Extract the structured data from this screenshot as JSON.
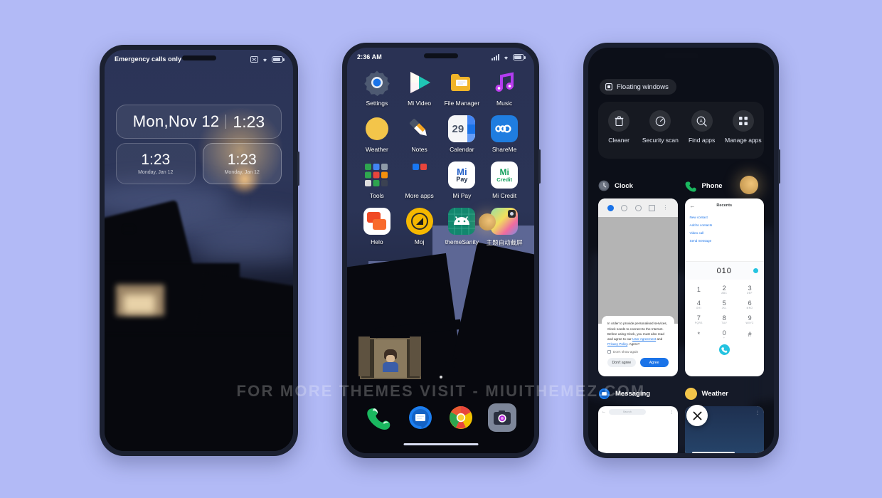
{
  "background_color": "#b2baf6",
  "watermark": "FOR MORE THEMES VISIT - MIUITHEMEZ.COM",
  "lockscreen": {
    "status_left": "Emergency calls only",
    "status_icons": [
      "no-sim-icon",
      "wifi-icon",
      "battery-icon"
    ],
    "widget_date": "Mon,Nov 12",
    "widget_time": "1:23",
    "small_widgets": [
      {
        "time": "1:23",
        "sub": "Monday, Jan 12"
      },
      {
        "time": "1:23",
        "sub": "Monday, Jan 12"
      }
    ]
  },
  "homescreen": {
    "status_time": "2:36 AM",
    "status_icons": [
      "signal-icon",
      "wifi-icon",
      "battery-icon"
    ],
    "apps": [
      {
        "label": "Settings",
        "icon": "settings-icon"
      },
      {
        "label": "Mi Video",
        "icon": "mi-video-icon"
      },
      {
        "label": "File Manager",
        "icon": "file-manager-icon"
      },
      {
        "label": "Music",
        "icon": "music-icon"
      },
      {
        "label": "Weather",
        "icon": "weather-icon"
      },
      {
        "label": "Notes",
        "icon": "notes-icon"
      },
      {
        "label": "Calendar",
        "icon": "calendar-icon",
        "badge": "29"
      },
      {
        "label": "ShareMe",
        "icon": "shareme-icon"
      },
      {
        "label": "Tools",
        "icon": "tools-folder-icon"
      },
      {
        "label": "More apps",
        "icon": "more-apps-folder-icon"
      },
      {
        "label": "Mi Pay",
        "icon": "mi-pay-icon"
      },
      {
        "label": "Mi Credit",
        "icon": "mi-credit-icon"
      },
      {
        "label": "Helo",
        "icon": "helo-icon"
      },
      {
        "label": "Moj",
        "icon": "moj-icon"
      },
      {
        "label": "themeSanity",
        "icon": "themesanity-icon"
      },
      {
        "label": "主题自动截屏",
        "icon": "auto-screenshot-icon"
      }
    ],
    "dock": [
      {
        "label": "Phone",
        "icon": "phone-icon"
      },
      {
        "label": "Messages",
        "icon": "messages-icon"
      },
      {
        "label": "Browser",
        "icon": "browser-icon"
      },
      {
        "label": "Camera",
        "icon": "camera-icon"
      }
    ]
  },
  "recents": {
    "chip_label": "Floating windows",
    "chip_icon": "floating-window-icon",
    "tools": [
      {
        "label": "Cleaner",
        "icon": "trash-icon"
      },
      {
        "label": "Security scan",
        "icon": "shield-scan-icon"
      },
      {
        "label": "Find apps",
        "icon": "search-apps-icon"
      },
      {
        "label": "Manage apps",
        "icon": "grid-apps-icon"
      }
    ],
    "windows": [
      {
        "name": "Clock",
        "icon": "clock-icon"
      },
      {
        "name": "Phone",
        "icon": "phone-icon"
      },
      {
        "name": "Messaging",
        "icon": "messaging-icon"
      },
      {
        "name": "Weather",
        "icon": "weather-icon"
      }
    ],
    "clock_window": {
      "dialog_text_1": "In order to provide personalised services, Clock needs to connect to the Internet. Before using Clock, you must also read and agree to our ",
      "link_user_agreement": "User Agreement",
      "dialog_text_2": " and ",
      "link_privacy_policy": "Privacy Policy",
      "dialog_text_3": ". Agree?",
      "checkbox_label": "Don't show again",
      "decline_label": "Don't agree",
      "accept_label": "Agree"
    },
    "phone_window": {
      "title": "Recents",
      "actions": [
        "New contact",
        "Add to contacts",
        "Video call",
        "Send message"
      ],
      "dialed_number": "010",
      "keys": [
        {
          "digit": "1",
          "letters": ""
        },
        {
          "digit": "2",
          "letters": "ABC"
        },
        {
          "digit": "3",
          "letters": "DEF"
        },
        {
          "digit": "4",
          "letters": "GHI"
        },
        {
          "digit": "5",
          "letters": "JKL"
        },
        {
          "digit": "6",
          "letters": "MNO"
        },
        {
          "digit": "7",
          "letters": "PQRS"
        },
        {
          "digit": "8",
          "letters": "TUV"
        },
        {
          "digit": "9",
          "letters": "WXYZ"
        },
        {
          "digit": "*",
          "letters": ""
        },
        {
          "digit": "0",
          "letters": "+"
        },
        {
          "digit": "#",
          "letters": ""
        }
      ]
    },
    "messaging_window": {
      "search_placeholder": "Search"
    },
    "close_icon": "close-icon"
  }
}
